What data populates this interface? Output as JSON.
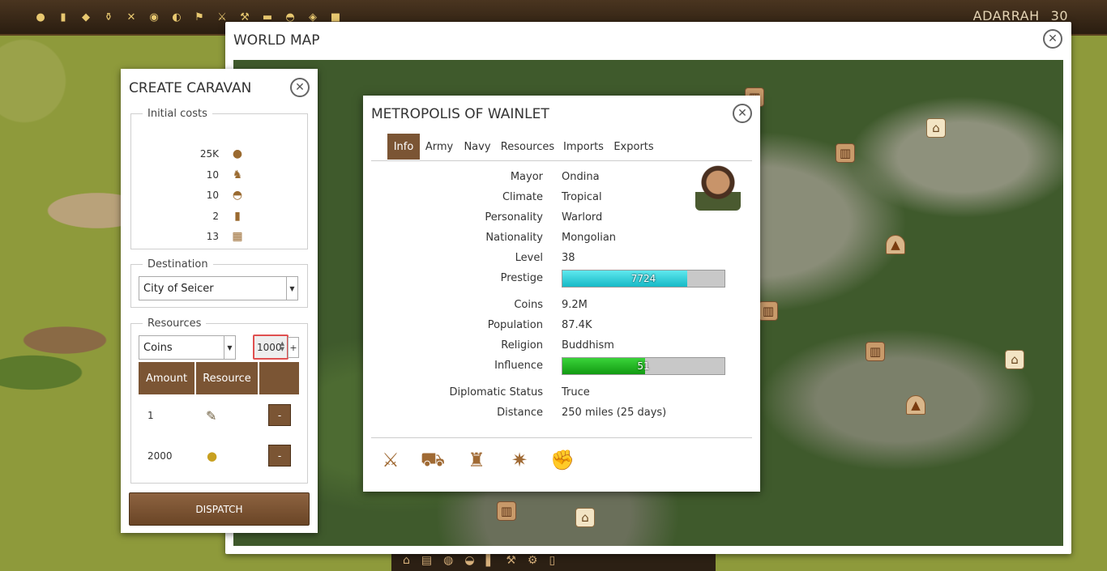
{
  "topbar": {
    "resource_icons": [
      "coins-icon",
      "wood-icon",
      "stone-icon",
      "pottery-icon",
      "tools-icon",
      "meat-icon",
      "fish-icon",
      "flag-icon",
      "weapons-icon",
      "hammer-icon",
      "gold-bar-icon",
      "bread-icon",
      "cloth-icon",
      "crystal-icon",
      "misc-icon"
    ],
    "player_name": "ADARRAH",
    "player_level": "30"
  },
  "world_map": {
    "title": "WORLD MAP"
  },
  "create_caravan": {
    "title": "CREATE CARAVAN",
    "initial_costs_legend": "Initial costs",
    "costs": [
      {
        "value": "25K",
        "icon": "coins-icon"
      },
      {
        "value": "10",
        "icon": "donkey-icon"
      },
      {
        "value": "10",
        "icon": "bread-icon"
      },
      {
        "value": "2",
        "icon": "wood-icon"
      },
      {
        "value": "13",
        "icon": "crate-icon"
      }
    ],
    "destination_legend": "Destination",
    "destination_value": "City of Seicer",
    "resources_legend": "Resources",
    "resource_select_value": "Coins",
    "amount_input_value": "1000",
    "add_label": "+",
    "table_headers": [
      "Amount",
      "Resource",
      ""
    ],
    "rows": [
      {
        "amount": "1",
        "resource_icon": "bottle-icon",
        "remove_label": "-"
      },
      {
        "amount": "2000",
        "resource_icon": "coins-icon",
        "remove_label": "-"
      }
    ],
    "dispatch_label": "DISPATCH"
  },
  "metropolis": {
    "title": "METROPOLIS OF WAINLET",
    "tabs": [
      "Info",
      "Army",
      "Navy",
      "Resources",
      "Imports",
      "Exports"
    ],
    "active_tab": "Info",
    "info": {
      "mayor_label": "Mayor",
      "mayor": "Ondina",
      "climate_label": "Climate",
      "climate": "Tropical",
      "personality_label": "Personality",
      "personality": "Warlord",
      "nationality_label": "Nationality",
      "nationality": "Mongolian",
      "level_label": "Level",
      "level": "38",
      "prestige_label": "Prestige",
      "prestige": "7724",
      "prestige_fraction": 0.77,
      "coins_label": "Coins",
      "coins": "9.2M",
      "population_label": "Population",
      "population": "87.4K",
      "religion_label": "Religion",
      "religion": "Buddhism",
      "influence_label": "Influence",
      "influence": "51",
      "influence_fraction": 0.51,
      "diplomatic_label": "Diplomatic Status",
      "diplomatic": "Truce",
      "distance_label": "Distance",
      "distance": "250 miles (25 days)"
    },
    "actions": [
      "attack-icon",
      "caravan-icon",
      "spy-icon",
      "magic-icon",
      "alliance-icon"
    ]
  },
  "colors": {
    "brown": "#7b5534",
    "prestige_bar": "#1ec9d6",
    "influence_bar": "#1fae1f"
  }
}
